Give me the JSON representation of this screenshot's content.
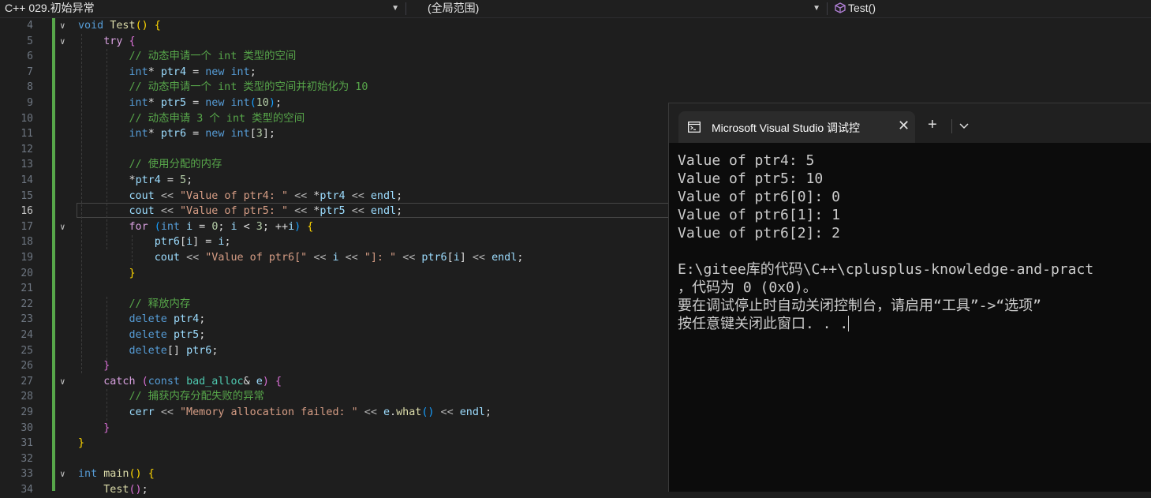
{
  "navbar": {
    "project": "C++ 029.初始异常",
    "scope": "(全局范围)",
    "function": "Test()"
  },
  "editor": {
    "current_line": "16",
    "lines": [
      {
        "n": "4",
        "fold": "∨",
        "html": "<span class='kw'>void</span> <span class='fn'>Test</span><span class='br1'>()</span> <span class='br1'>{</span>"
      },
      {
        "n": "5",
        "fold": "∨",
        "html": "    <span class='ct'>try</span> <span class='br2'>{</span>"
      },
      {
        "n": "6",
        "fold": "",
        "html": "        <span class='cm'>// 动态申请一个 int 类型的空间</span>"
      },
      {
        "n": "7",
        "fold": "",
        "html": "        <span class='kw'>int</span>* <span class='id'>ptr4</span> = <span class='kw'>new</span> <span class='kw'>int</span>;"
      },
      {
        "n": "8",
        "fold": "",
        "html": "        <span class='cm'>// 动态申请一个 int 类型的空间并初始化为 10</span>"
      },
      {
        "n": "9",
        "fold": "",
        "html": "        <span class='kw'>int</span>* <span class='id'>ptr5</span> = <span class='kw'>new</span> <span class='kw'>int</span><span class='br3'>(</span><span class='num'>10</span><span class='br3'>)</span>;"
      },
      {
        "n": "10",
        "fold": "",
        "html": "        <span class='cm'>// 动态申请 3 个 int 类型的空间</span>"
      },
      {
        "n": "11",
        "fold": "",
        "html": "        <span class='kw'>int</span>* <span class='id'>ptr6</span> = <span class='kw'>new</span> <span class='kw'>int</span>[<span class='num'>3</span>];"
      },
      {
        "n": "12",
        "fold": "",
        "html": ""
      },
      {
        "n": "13",
        "fold": "",
        "html": "        <span class='cm'>// 使用分配的内存</span>"
      },
      {
        "n": "14",
        "fold": "",
        "html": "        *<span class='id'>ptr4</span> = <span class='num'>5</span>;"
      },
      {
        "n": "15",
        "fold": "",
        "html": "        <span class='id'>cout</span> <span class='op'>&lt;&lt;</span> <span class='str'>\"Value of ptr4: \"</span> <span class='op'>&lt;&lt;</span> *<span class='id'>ptr4</span> <span class='op'>&lt;&lt;</span> <span class='id'>endl</span>;"
      },
      {
        "n": "16",
        "fold": "",
        "html": "        <span class='id'>cout</span> <span class='op'>&lt;&lt;</span> <span class='str'>\"Value of ptr5: \"</span> <span class='op'>&lt;&lt;</span> *<span class='id'>ptr5</span> <span class='op'>&lt;&lt;</span> <span class='id'>endl</span>;"
      },
      {
        "n": "17",
        "fold": "∨",
        "html": "        <span class='ct'>for</span> <span class='br3'>(</span><span class='kw'>int</span> <span class='id'>i</span> = <span class='num'>0</span>; <span class='id'>i</span> &lt; <span class='num'>3</span>; ++<span class='id'>i</span><span class='br3'>)</span> <span class='br1'>{</span>"
      },
      {
        "n": "18",
        "fold": "",
        "html": "            <span class='id'>ptr6</span>[<span class='id'>i</span>] = <span class='id'>i</span>;"
      },
      {
        "n": "19",
        "fold": "",
        "html": "            <span class='id'>cout</span> <span class='op'>&lt;&lt;</span> <span class='str'>\"Value of ptr6[\"</span> <span class='op'>&lt;&lt;</span> <span class='id'>i</span> <span class='op'>&lt;&lt;</span> <span class='str'>\"]: \"</span> <span class='op'>&lt;&lt;</span> <span class='id'>ptr6</span>[<span class='id'>i</span>] <span class='op'>&lt;&lt;</span> <span class='id'>endl</span>;"
      },
      {
        "n": "20",
        "fold": "",
        "html": "        <span class='br1'>}</span>"
      },
      {
        "n": "21",
        "fold": "",
        "html": ""
      },
      {
        "n": "22",
        "fold": "",
        "html": "        <span class='cm'>// 释放内存</span>"
      },
      {
        "n": "23",
        "fold": "",
        "html": "        <span class='kw'>delete</span> <span class='id'>ptr4</span>;"
      },
      {
        "n": "24",
        "fold": "",
        "html": "        <span class='kw'>delete</span> <span class='id'>ptr5</span>;"
      },
      {
        "n": "25",
        "fold": "",
        "html": "        <span class='kw'>delete</span>[] <span class='id'>ptr6</span>;"
      },
      {
        "n": "26",
        "fold": "",
        "html": "    <span class='br2'>}</span>"
      },
      {
        "n": "27",
        "fold": "∨",
        "html": "    <span class='ct'>catch</span> <span class='br2'>(</span><span class='kw'>const</span> <span class='ty'>bad_alloc</span>&amp; <span class='id'>e</span><span class='br2'>)</span> <span class='br2'>{</span>"
      },
      {
        "n": "28",
        "fold": "",
        "html": "        <span class='cm'>// 捕获内存分配失败的异常</span>"
      },
      {
        "n": "29",
        "fold": "",
        "html": "        <span class='id'>cerr</span> <span class='op'>&lt;&lt;</span> <span class='str'>\"Memory allocation failed: \"</span> <span class='op'>&lt;&lt;</span> <span class='id'>e</span>.<span class='fn'>what</span><span class='br3'>()</span> <span class='op'>&lt;&lt;</span> <span class='id'>endl</span>;"
      },
      {
        "n": "30",
        "fold": "",
        "html": "    <span class='br2'>}</span>"
      },
      {
        "n": "31",
        "fold": "",
        "html": "<span class='br1'>}</span>"
      },
      {
        "n": "32",
        "fold": "",
        "html": ""
      },
      {
        "n": "33",
        "fold": "∨",
        "html": "<span class='kw'>int</span> <span class='fn'>main</span><span class='br1'>()</span> <span class='br1'>{</span>"
      },
      {
        "n": "34",
        "fold": "",
        "html": "    <span class='fn'>Test</span><span class='br2'>()</span>;"
      }
    ]
  },
  "console": {
    "tab_title": "Microsoft Visual Studio 调试控",
    "new_tab": "+",
    "close": "✕",
    "dropdown": "⌄",
    "lines": [
      "Value of ptr4: 5",
      "Value of ptr5: 10",
      "Value of ptr6[0]: 0",
      "Value of ptr6[1]: 1",
      "Value of ptr6[2]: 2",
      "",
      "E:\\gitee库的代码\\C++\\cplusplus-knowledge-and-pract",
      "，代码为 0 (0x0)。",
      "要在调试停止时自动关闭控制台，请启用“工具”->“选项”",
      "按任意键关闭此窗口. . ."
    ]
  }
}
